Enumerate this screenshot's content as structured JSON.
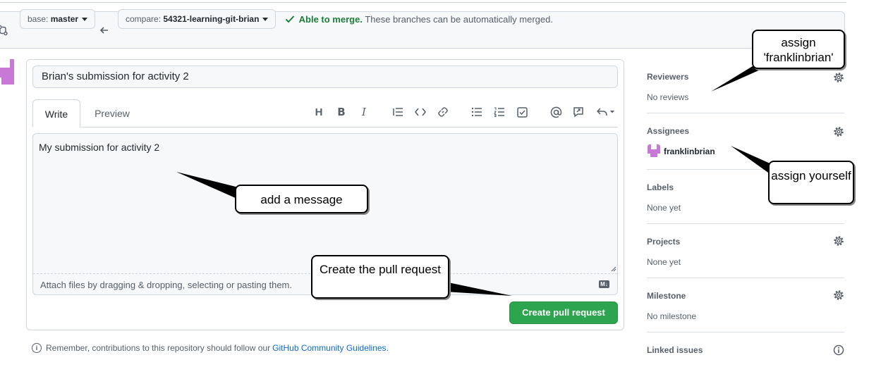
{
  "compare": {
    "base_prefix": "base:",
    "base_branch": "master",
    "compare_prefix": "compare:",
    "compare_branch": "54321-learning-git-brian",
    "merge_ok": "Able to merge.",
    "merge_text": "These branches can be automatically merged."
  },
  "form": {
    "title_value": "Brian's submission for activity 2",
    "tabs": [
      "Write",
      "Preview"
    ],
    "body_value": "My submission for activity 2",
    "attach_hint": "Attach files by dragging & dropping, selecting or pasting them.",
    "markdown_badge": "M↓",
    "submit_label": "Create pull request"
  },
  "footer": {
    "text": "Remember, contributions to this repository should follow our",
    "link": "GitHub Community Guidelines",
    "end": "."
  },
  "sidebar": {
    "reviewers": {
      "title": "Reviewers",
      "value": "No reviews"
    },
    "assignees": {
      "title": "Assignees",
      "value": "franklinbrian"
    },
    "labels": {
      "title": "Labels",
      "value": "None yet"
    },
    "projects": {
      "title": "Projects",
      "value": "None yet"
    },
    "milestone": {
      "title": "Milestone",
      "value": "No milestone"
    },
    "linked_issues": {
      "title": "Linked issues"
    }
  },
  "callouts": {
    "assign_reviewer": "assign 'franklinbrian'",
    "assign_yourself": "assign yourself",
    "add_message": "add a message",
    "create_pr": "Create the pull request"
  },
  "colors": {
    "accent_green": "#2da44e",
    "merge_green": "#1a7f37",
    "link_blue": "#0969da",
    "avatar_purple": "#c879d6"
  },
  "icons": [
    "git-compare-icon",
    "arrow-left-icon",
    "check-icon",
    "heading-icon",
    "bold-icon",
    "italic-icon",
    "quote-icon",
    "code-icon",
    "link-icon",
    "unordered-list-icon",
    "ordered-list-icon",
    "task-list-icon",
    "mention-icon",
    "reference-icon",
    "reply-icon",
    "gear-icon",
    "info-icon",
    "markdown-icon"
  ]
}
